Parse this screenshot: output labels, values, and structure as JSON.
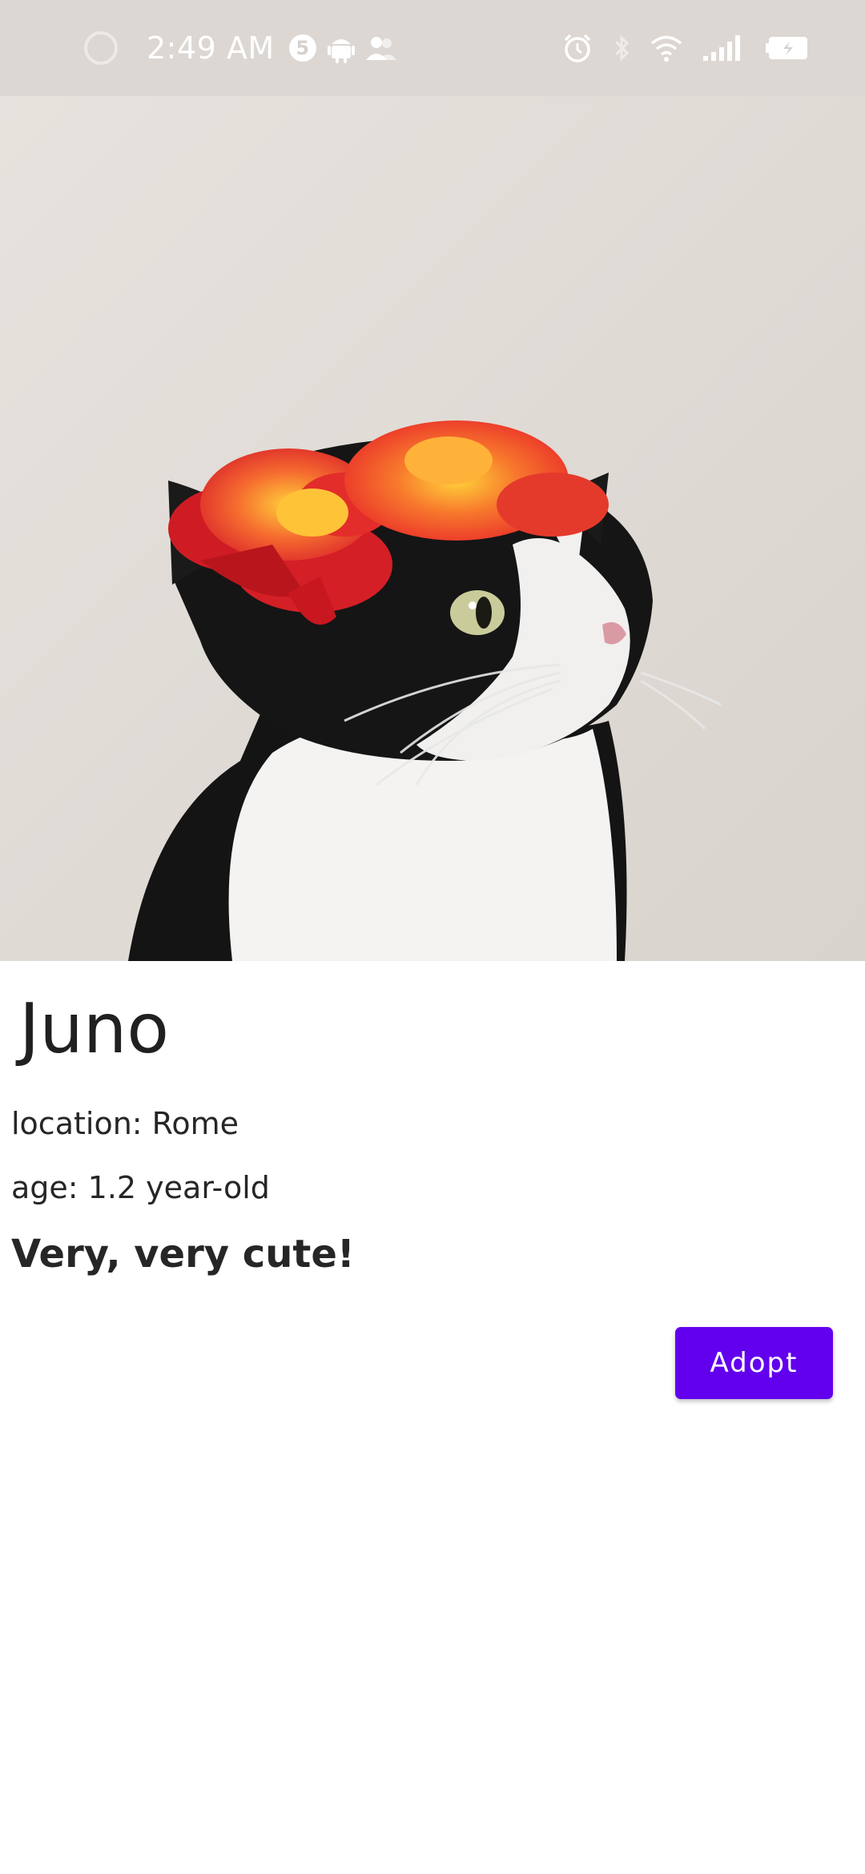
{
  "status_bar": {
    "time": "2:49 AM",
    "notification_count": "5",
    "icons": [
      "screen-record-icon",
      "notification-count-icon",
      "android-icon",
      "contacts-icon",
      "alarm-icon",
      "bluetooth-icon",
      "wifi-icon",
      "signal-icon",
      "battery-icon"
    ]
  },
  "pet": {
    "image_icon": "cat-photo",
    "name": "Juno",
    "location": "location: Rome",
    "age": "age: 1.2 year-old",
    "description": "Very, very cute!"
  },
  "actions": {
    "adopt_label": "Adopt"
  },
  "colors": {
    "accent": "#6200ee",
    "status_bar": "#dcd7d2",
    "text": "#262626"
  }
}
